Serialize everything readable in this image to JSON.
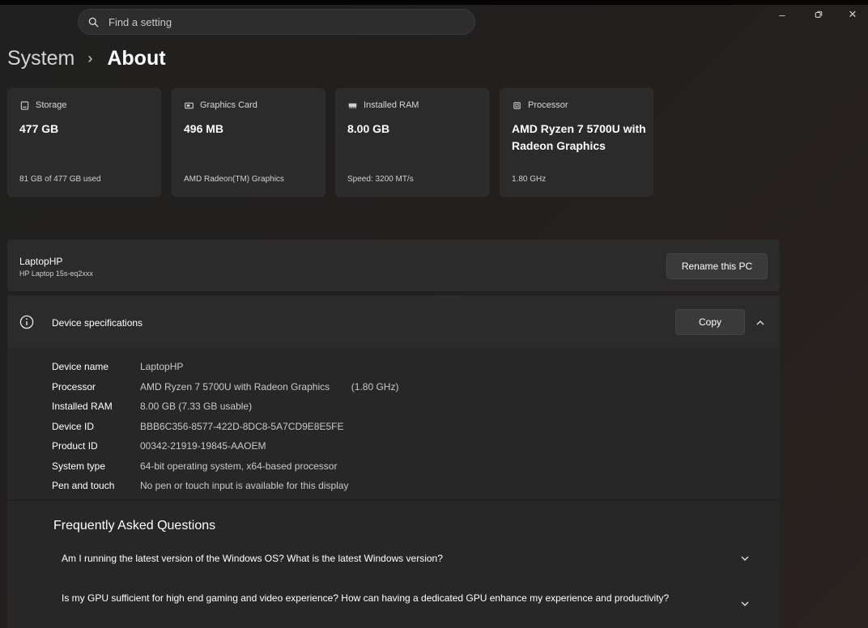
{
  "search": {
    "placeholder": "Find a setting"
  },
  "window_controls": {
    "minimize": "–",
    "restore": "⧉",
    "close": "✕"
  },
  "breadcrumb": {
    "parent": "System",
    "separator": "›",
    "current": "About"
  },
  "cards": [
    {
      "icon": "storage-icon",
      "label": "Storage",
      "value": "477 GB",
      "sub": "81 GB of 477 GB used"
    },
    {
      "icon": "graphics-card-icon",
      "label": "Graphics Card",
      "value": "496 MB",
      "sub": "AMD Radeon(TM) Graphics"
    },
    {
      "icon": "ram-icon",
      "label": "Installed RAM",
      "value": "8.00 GB",
      "sub": "Speed: 3200 MT/s"
    },
    {
      "icon": "processor-icon",
      "label": "Processor",
      "value": "AMD Ryzen 7 5700U with Radeon Graphics",
      "sub": "1.80 GHz"
    }
  ],
  "pc": {
    "name": "LaptopHP",
    "model": "HP Laptop 15s-eq2xxx",
    "rename_label": "Rename this PC"
  },
  "device_specs": {
    "heading": "Device specifications",
    "copy_label": "Copy",
    "rows": [
      {
        "key": "Device name",
        "value": "LaptopHP"
      },
      {
        "key": "Processor",
        "value": "AMD Ryzen 7 5700U with Radeon Graphics        (1.80 GHz)"
      },
      {
        "key": "Installed RAM",
        "value": "8.00 GB (7.33 GB usable)"
      },
      {
        "key": "Device ID",
        "value": "BBB6C356-8577-422D-8DC8-5A7CD9E8E5FE"
      },
      {
        "key": "Product ID",
        "value": "00342-21919-19845-AAOEM"
      },
      {
        "key": "System type",
        "value": "64-bit operating system, x64-based processor"
      },
      {
        "key": "Pen and touch",
        "value": "No pen or touch input is available for this display"
      }
    ]
  },
  "faq": {
    "title": "Frequently Asked Questions",
    "items": [
      {
        "question": "Am I running the latest version of the Windows OS? What is the latest Windows version?"
      },
      {
        "question": "Is my GPU sufficient for high end gaming and video experience? How can having a dedicated GPU enhance my experience and productivity?"
      }
    ]
  }
}
